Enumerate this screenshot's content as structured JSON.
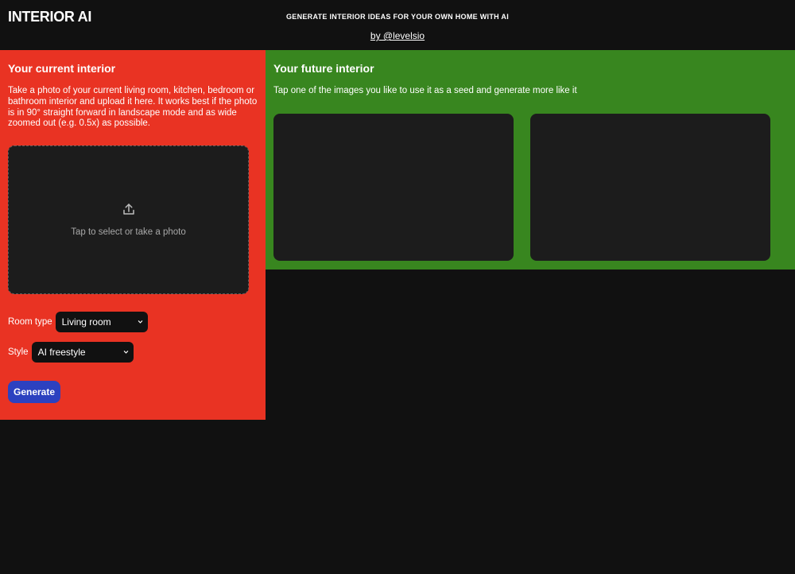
{
  "header": {
    "brand": "INTERIOR AI",
    "tagline": "GENERATE INTERIOR IDEAS FOR YOUR OWN HOME WITH AI",
    "byline": "by @levelsio"
  },
  "current": {
    "title": "Your current interior",
    "description": "Take a photo of your current living room, kitchen, bedroom or bathroom interior and upload it here. It works best if the photo is in 90° straight forward in landscape mode and as wide zoomed out (e.g. 0.5x) as possible.",
    "upload": {
      "icon": "upload-icon",
      "text": "Tap to select or take a photo"
    },
    "room_type": {
      "label": "Room type",
      "selected": "Living room"
    },
    "style": {
      "label": "Style",
      "selected": "AI freestyle"
    },
    "generate_label": "Generate",
    "color": "#e93323"
  },
  "future": {
    "title": "Your future interior",
    "description": "Tap one of the images you like to use it as a seed and generate more like it",
    "color": "#38861f",
    "images_count": 2
  },
  "colors": {
    "background": "#111111",
    "button": "#2c41c0",
    "placeholder": "#1c1c1c"
  }
}
